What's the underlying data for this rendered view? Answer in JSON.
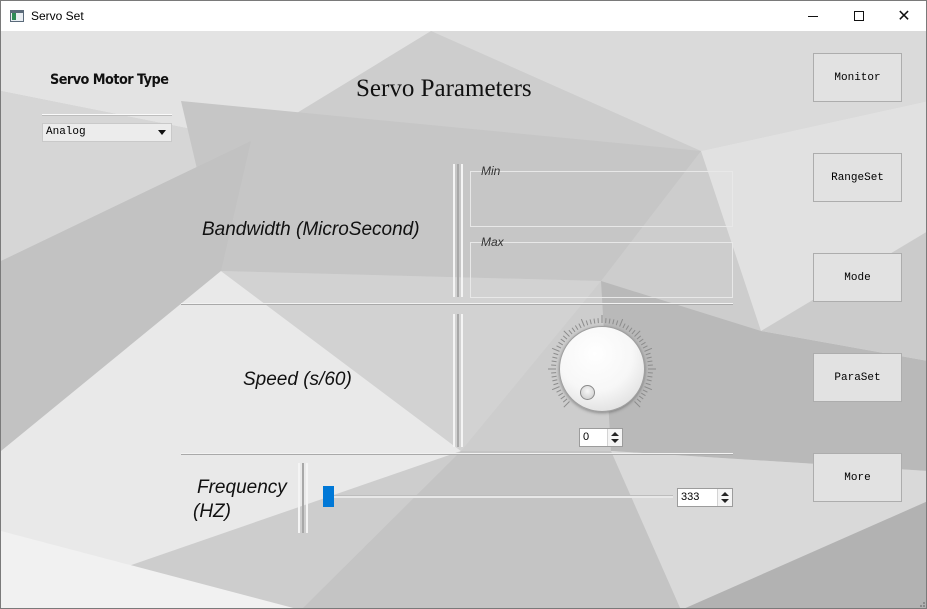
{
  "window": {
    "title": "Servo Set",
    "controls": {
      "minimize": "",
      "maximize": "",
      "close": "✕"
    }
  },
  "servo_type": {
    "label": "Servo Motor Type",
    "selected": "Analog"
  },
  "page_title": "Servo Parameters",
  "bandwidth": {
    "label": "Bandwidth (MicroSecond)",
    "min_title": "Min",
    "max_title": "Max"
  },
  "speed": {
    "label": "Speed (s/60)",
    "dial_value": "0"
  },
  "frequency": {
    "label_line1": "Frequency",
    "label_line2": "(HZ)",
    "value": "333",
    "slider_fraction": 0.0
  },
  "side_buttons": {
    "monitor": "Monitor",
    "rangeset": "RangeSet",
    "mode": "Mode",
    "paraset": "ParaSet",
    "more": "More"
  },
  "colors": {
    "slider_accent": "#0078d7",
    "background": "#cfcfcf"
  },
  "icons": {
    "app": "window-app-icon",
    "minimize": "minimize-icon",
    "maximize": "maximize-icon",
    "close": "close-icon",
    "dropdown": "chevron-down-icon",
    "spin_up": "spin-up-icon",
    "spin_down": "spin-down-icon"
  }
}
